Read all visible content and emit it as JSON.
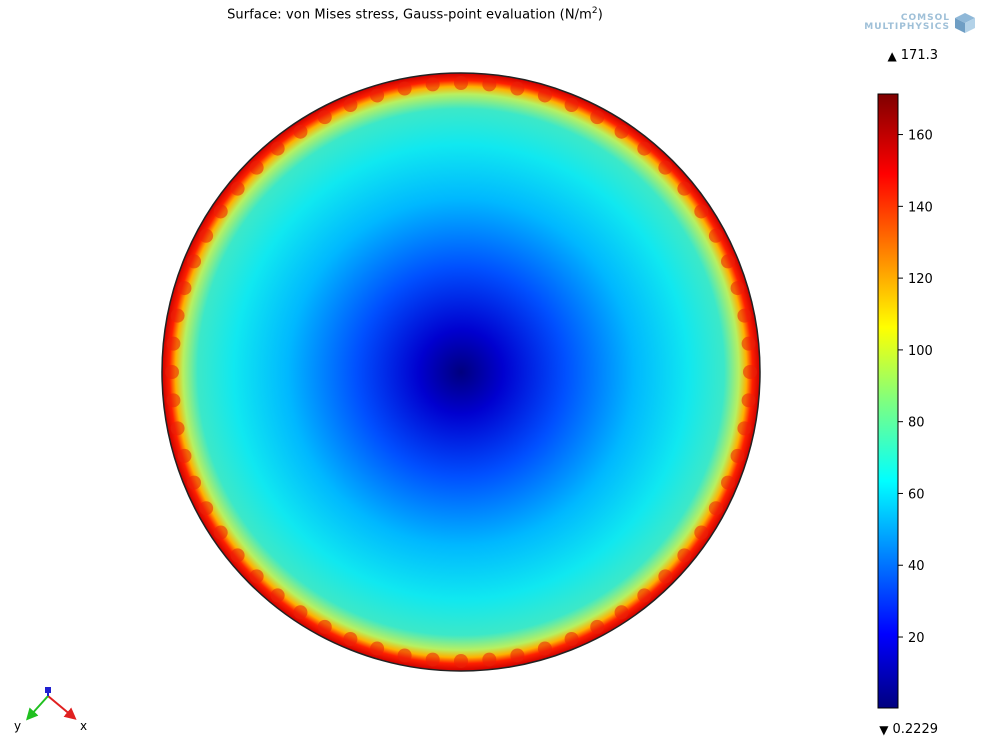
{
  "plot": {
    "title_main": "Surface: von Mises stress, Gauss-point evaluation (N/m",
    "title_sup": "2",
    "title_end": ")",
    "logo_line1": "COMSOL",
    "logo_line2": "MULTIPHYSICS",
    "max_value": "171.3",
    "min_value": "0.2229",
    "colorbar_ticks": [
      "20",
      "40",
      "60",
      "80",
      "100",
      "120",
      "140",
      "160"
    ],
    "axis_x": "x",
    "axis_y": "y",
    "max_symbol": "▲",
    "min_symbol": "▼"
  },
  "chart_data": {
    "type": "heatmap",
    "title": "Surface: von Mises stress, Gauss-point evaluation (N/m²)",
    "colorbar": {
      "min": 0.2229,
      "max": 171.3,
      "ticks": [
        20,
        40,
        60,
        80,
        100,
        120,
        140,
        160
      ],
      "colormap": "rainbow"
    },
    "field": {
      "shape": "disk",
      "center_value": 0.2229,
      "edge_value": 171.3
    }
  },
  "colors": {
    "colormap_stops": [
      "#00007f",
      "#0000ff",
      "#00ffff",
      "#7fff7f",
      "#ffff00",
      "#ff0000",
      "#7f0000"
    ]
  },
  "icons": {
    "logo": "comsol-cube-icon",
    "axis": "axis-triad-icon"
  }
}
